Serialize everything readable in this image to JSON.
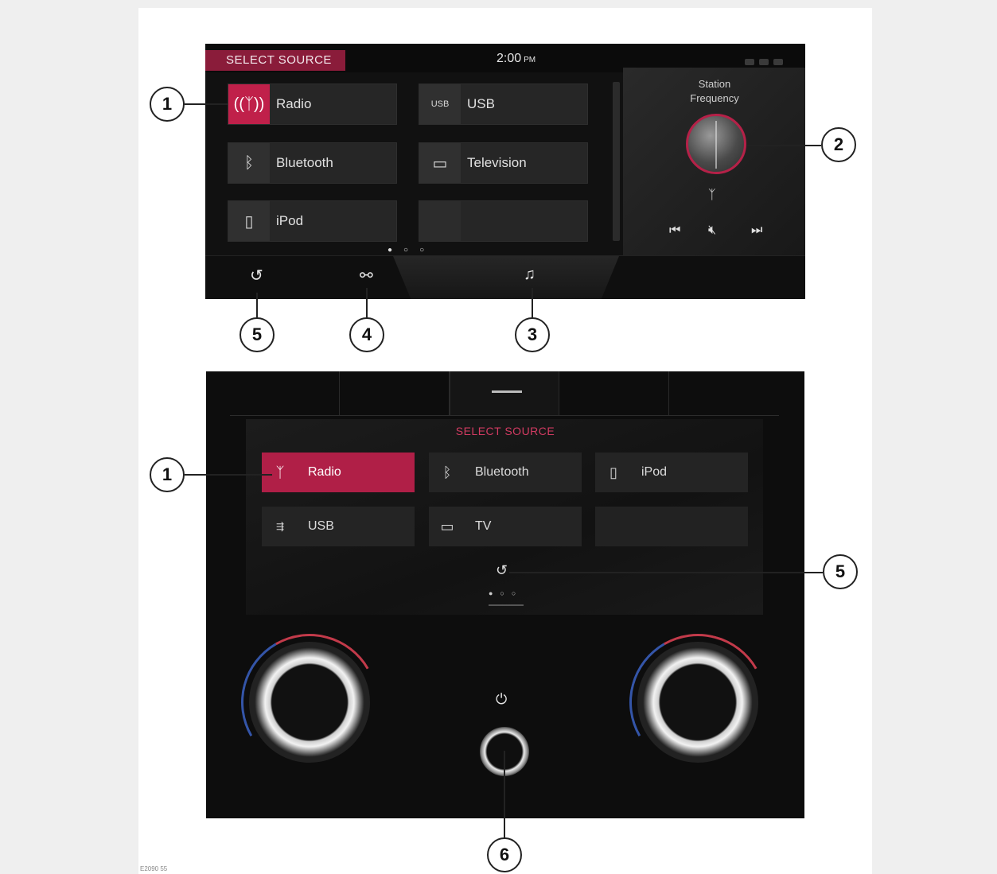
{
  "upper_screen": {
    "title": "SELECT SOURCE",
    "time": "2:00",
    "time_suffix": "PM",
    "sources": [
      {
        "label": "Radio",
        "icon": "radio-antenna-icon",
        "active": true
      },
      {
        "label": "USB",
        "icon": "usb-icon"
      },
      {
        "label": "Bluetooth",
        "icon": "bluetooth-icon"
      },
      {
        "label": "Television",
        "icon": "television-icon"
      },
      {
        "label": "iPod",
        "icon": "ipod-icon"
      },
      {
        "label": "",
        "icon": ""
      }
    ],
    "usb_icon_text": "USB",
    "station_label": "Station Frequency",
    "accent_color": "#c0204a"
  },
  "lower_screen": {
    "title": "SELECT SOURCE",
    "sources": [
      {
        "label": "Radio",
        "icon": "radio-antenna-icon",
        "active": true
      },
      {
        "label": "Bluetooth",
        "icon": "bluetooth-icon"
      },
      {
        "label": "iPod",
        "icon": "ipod-icon"
      },
      {
        "label": "USB",
        "icon": "usb-icon"
      },
      {
        "label": "TV",
        "icon": "television-icon"
      },
      {
        "label": "",
        "icon": ""
      }
    ],
    "accent_color": "#b01f47"
  },
  "callouts": {
    "c1a": "1",
    "c2": "2",
    "c5a": "5",
    "c4": "4",
    "c3": "3",
    "c1b": "1",
    "c5b": "5",
    "c6": "6"
  },
  "figure_code": "E2090 55"
}
